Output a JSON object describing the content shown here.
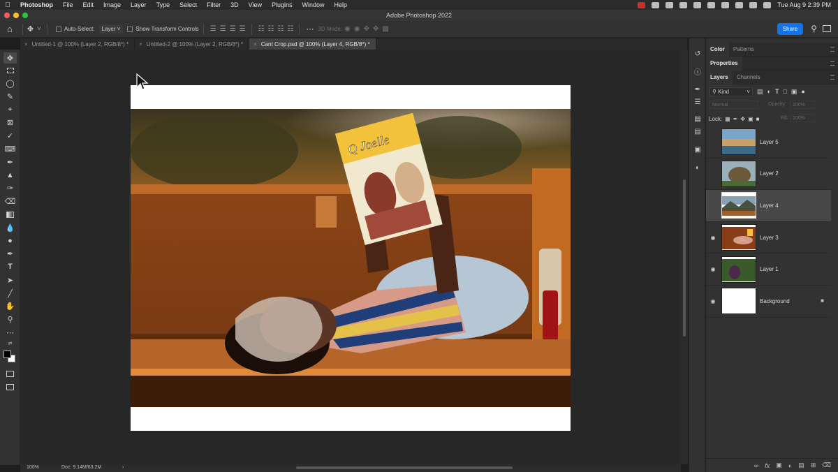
{
  "menubar": {
    "app": "Photoshop",
    "items": [
      "File",
      "Edit",
      "Image",
      "Layer",
      "Type",
      "Select",
      "Filter",
      "3D",
      "View",
      "Plugins",
      "Window",
      "Help"
    ],
    "clock": "Tue Aug 9  2:39 PM"
  },
  "window": {
    "title": "Adobe Photoshop 2022"
  },
  "options_bar": {
    "auto_select_label": "Auto-Select:",
    "auto_select_value": "Layer",
    "show_transform_label": "Show Transform Controls",
    "mode_3d_label": "3D Mode:",
    "share_label": "Share"
  },
  "tabs": [
    {
      "label": "Untitled-1 @ 100% (Layer 2, RGB/8*) *",
      "close": "×"
    },
    {
      "label": "Untitled-2 @ 100% (Layer 2, RGB/8*) *",
      "close": "×"
    },
    {
      "label": "Cant Crop.psd @ 100% (Layer 4, RGB/8*) *",
      "close": "×"
    }
  ],
  "panels": {
    "top_tabs": [
      "Color",
      "Patterns"
    ],
    "properties_tab": "Properties",
    "layer_tabs": [
      "Layers",
      "Channels"
    ],
    "filter_kind": "Kind",
    "blend_mode": "Normal",
    "opacity_label": "Opacity:",
    "opacity_value": "100%",
    "lock_label": "Lock:",
    "fill_label": "Fill:",
    "fill_value": "100%"
  },
  "layers": [
    {
      "name": "Layer 5",
      "visible": false,
      "selected": false
    },
    {
      "name": "Layer 2",
      "visible": false,
      "selected": false
    },
    {
      "name": "Layer 4",
      "visible": false,
      "selected": true
    },
    {
      "name": "Layer 3",
      "visible": true,
      "selected": false
    },
    {
      "name": "Layer 1",
      "visible": true,
      "selected": false
    },
    {
      "name": "Background",
      "visible": true,
      "selected": false,
      "locked": true
    }
  ],
  "status": {
    "zoom": "100%",
    "doc": "Doc: 9.14M/63.2M",
    "arrow": "›"
  },
  "colors": {
    "accent": "#1473e6",
    "foreground": "#000000",
    "background": "#ffffff"
  }
}
